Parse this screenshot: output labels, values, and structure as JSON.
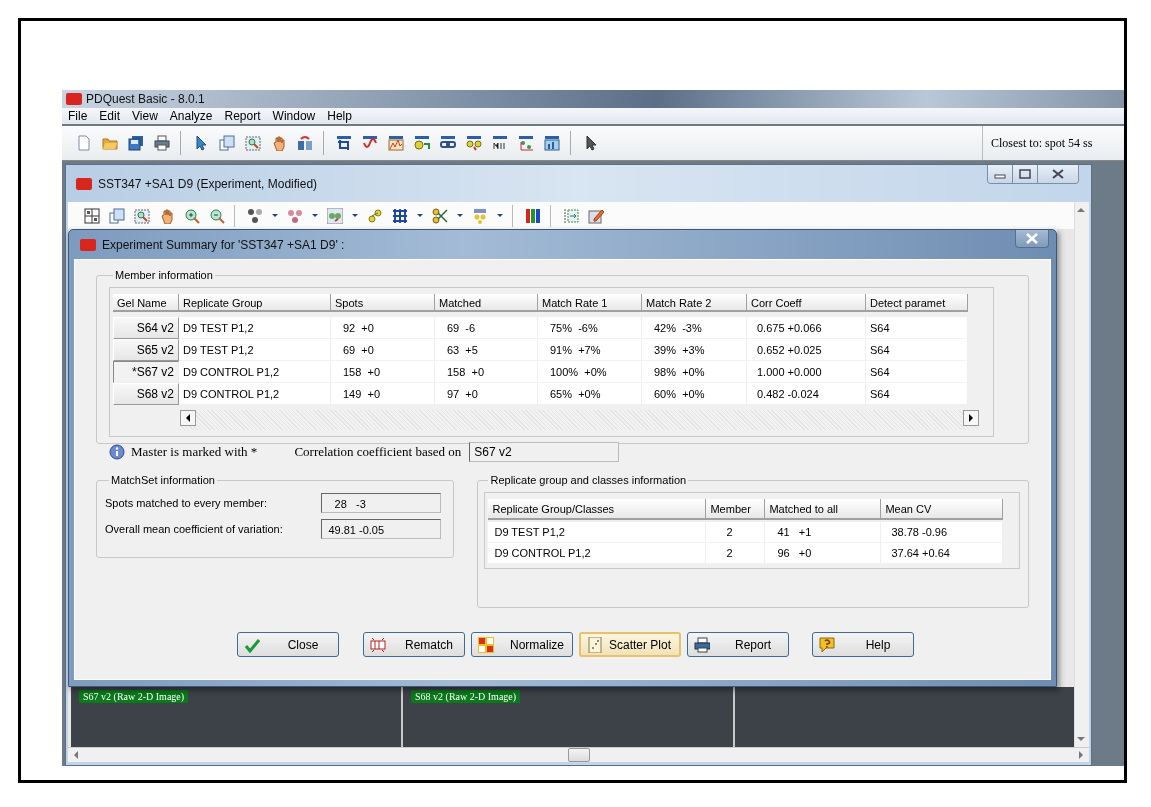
{
  "app": {
    "title": "PDQuest Basic - 8.0.1",
    "menu": [
      "File",
      "Edit",
      "View",
      "Analyze",
      "Report",
      "Window",
      "Help"
    ],
    "status": "Closest to: spot 54 ss"
  },
  "child_window": {
    "title": "SST347 +SA1 D9 (Experiment, Modified)"
  },
  "dialog": {
    "title": "Experiment Summary for 'SST347 +SA1 D9' :",
    "member_information": {
      "label": "Member information",
      "columns": [
        "Gel Name",
        "Replicate Group",
        "Spots",
        "Matched",
        "Match Rate 1",
        "Match Rate 2",
        "Corr Coeff",
        "Detect paramet"
      ],
      "rows": [
        {
          "selected": false,
          "cells": [
            "S64 v2",
            "D9 TEST P1,2",
            "92  +0",
            "69  -6",
            "75%  -6%",
            "42%  -3%",
            "0.675 +0.066",
            "S64"
          ]
        },
        {
          "selected": false,
          "cells": [
            "S65 v2",
            "D9 TEST P1,2",
            "69  +0",
            "63  +5",
            "91%  +7%",
            "39%  +3%",
            "0.652 +0.025",
            "S64"
          ]
        },
        {
          "selected": true,
          "cells": [
            "*S67 v2",
            "D9 CONTROL P1,2",
            "158  +0",
            "158  +0",
            "100%  +0%",
            "98%  +0%",
            "1.000 +0.000",
            "S64"
          ]
        },
        {
          "selected": false,
          "cells": [
            "S68 v2",
            "D9 CONTROL P1,2",
            "149  +0",
            "97  +0",
            "65%  +0%",
            "60%  +0%",
            "0.482 -0.024",
            "S64"
          ]
        }
      ],
      "master_note": "Master is marked with *",
      "correlation_label": "Correlation coefficient based on",
      "correlation_value": "S67 v2"
    },
    "matchset": {
      "label": "MatchSet information",
      "fields": [
        {
          "label": "Spots matched to every member:",
          "value": "  28   -3"
        },
        {
          "label": "Overall mean coefficient of variation:",
          "value": "49.81 -0.05"
        }
      ]
    },
    "replicate": {
      "label": "Replicate group and classes information",
      "columns": [
        "Replicate Group/Classes",
        "Member",
        "Matched to all",
        "Mean CV"
      ],
      "rows": [
        [
          "D9 TEST P1,2",
          "2",
          "41   +1",
          "38.78 -0.96"
        ],
        [
          "D9 CONTROL P1,2",
          "2",
          "96   +0",
          "37.64 +0.64"
        ]
      ]
    },
    "buttons": [
      {
        "kind": "close",
        "label": "Close",
        "focused": false
      },
      {
        "kind": "rematch",
        "label": "Rematch",
        "focused": false
      },
      {
        "kind": "normalize",
        "label": "Normalize",
        "focused": false
      },
      {
        "kind": "scatter",
        "label": "Scatter Plot",
        "focused": true
      },
      {
        "kind": "report",
        "label": "Report",
        "focused": false
      },
      {
        "kind": "help",
        "label": "Help",
        "focused": false
      }
    ]
  },
  "image_labels": [
    "S67 v2 (Raw 2-D Image)",
    "S68 v2 (Raw 2-D Image)"
  ]
}
